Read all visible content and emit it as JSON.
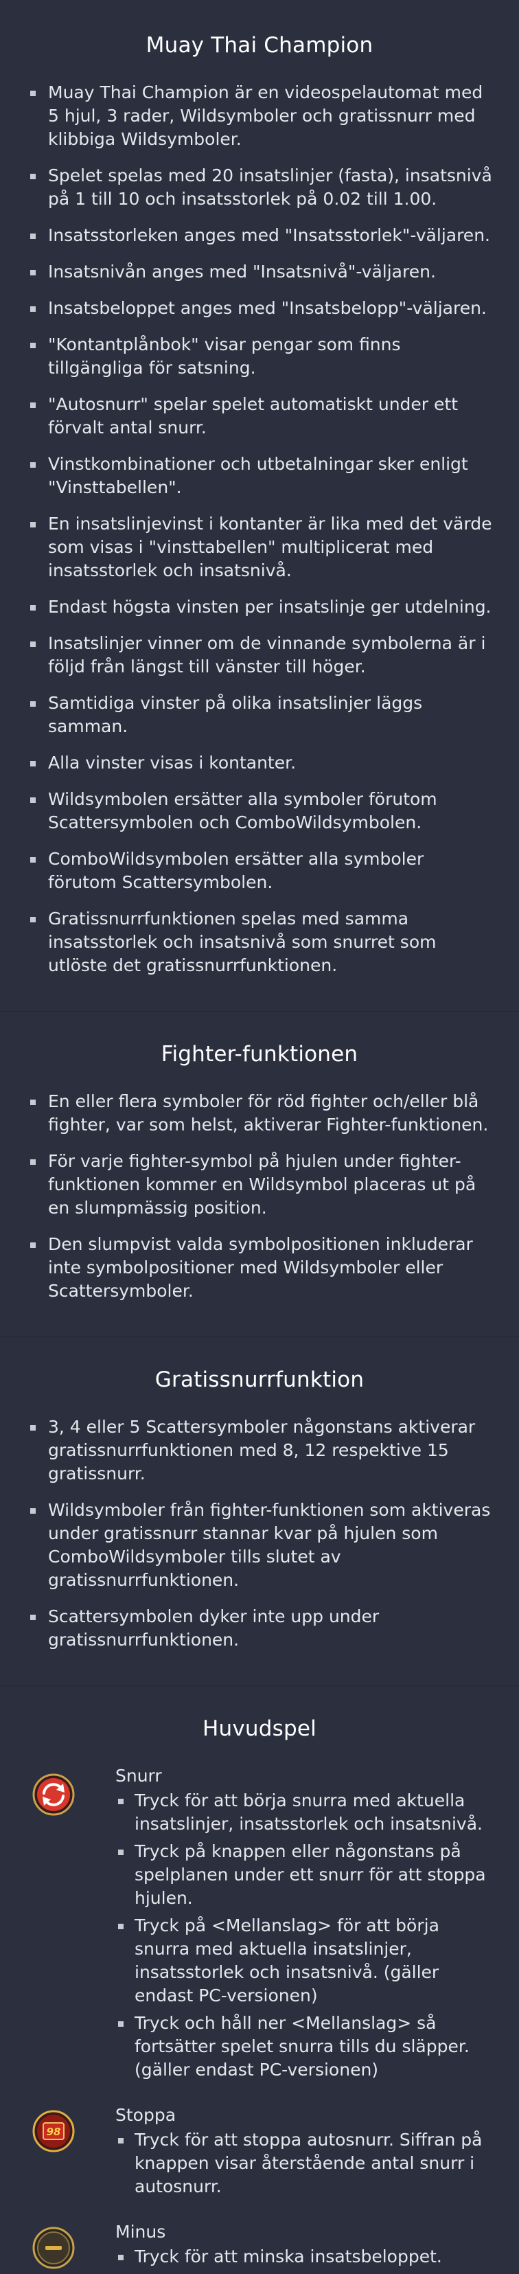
{
  "intro": {
    "title": "Muay Thai Champion",
    "items": [
      "Muay Thai Champion är en videospelautomat med 5 hjul, 3 rader, Wildsymboler och gratissnurr med klibbiga Wildsymboler.",
      "Spelet spelas med 20 insatslinjer (fasta), insatsnivå på 1 till 10 och insatsstorlek på 0.02 till 1.00.",
      "Insatsstorleken anges med \"Insatsstorlek\"-väljaren.",
      "Insatsnivån anges med \"Insatsnivå\"-väljaren.",
      "Insatsbeloppet anges med \"Insatsbelopp\"-väljaren.",
      "\"Kontantplånbok\" visar pengar som finns tillgängliga för satsning.",
      "\"Autosnurr\" spelar spelet automatiskt under ett förvalt antal snurr.",
      "Vinstkombinationer och utbetalningar sker enligt \"Vinsttabellen\".",
      "En insatslinjevinst i kontanter är lika med det värde som visas i \"vinsttabellen\" multiplicerat med insatsstorlek och insatsnivå.",
      "Endast högsta vinsten per insatslinje ger utdelning.",
      "Insatslinjer vinner om de vinnande symbolerna är i följd från längst till vänster till höger.",
      "Samtidiga vinster på olika insatslinjer läggs samman.",
      "Alla vinster visas i kontanter.",
      "Wildsymbolen ersätter alla symboler förutom Scattersymbolen och ComboWildsymbolen.",
      "ComboWildsymbolen ersätter alla symboler förutom Scattersymbolen.",
      "Gratissnurrfunktionen spelas med samma insatsstorlek och insatsnivå som snurret som utlöste det gratissnurrfunktionen."
    ]
  },
  "fighter": {
    "title": "Fighter-funktionen",
    "items": [
      "En eller flera symboler för röd fighter och/eller blå fighter, var som helst, aktiverar Fighter-funktionen.",
      "För varje fighter-symbol på hjulen under fighter-funktionen kommer en Wildsymbol placeras ut på en slumpmässig position.",
      "Den slumpvist valda symbolpositionen inkluderar inte symbolpositioner med Wildsymboler eller Scattersymboler."
    ]
  },
  "freespins": {
    "title": "Gratissnurrfunktion",
    "items": [
      "3, 4 eller 5 Scattersymboler någonstans aktiverar gratissnurrfunktionen med 8, 12 respektive 15 gratissnurr.",
      "Wildsymboler från fighter-funktionen som aktiveras under gratissnurr stannar kvar på hjulen som ComboWildsymboler tills slutet av gratissnurrfunktionen.",
      "Scattersymbolen dyker inte upp under gratissnurrfunktionen."
    ]
  },
  "main": {
    "title": "Huvudspel",
    "spin": {
      "icon": "spin-icon",
      "title": "Snurr",
      "items": [
        "Tryck för att börja snurra med aktuella insatslinjer, insatsstorlek och insatsnivå.",
        "Tryck på knappen eller någonstans på spelplanen under ett snurr för att stoppa hjulen.",
        "Tryck på <Mellanslag> för att börja snurra med aktuella insatslinjer, insatsstorlek och insatsnivå. (gäller endast PC-versionen)",
        "Tryck och håll ner <Mellanslag> så fortsätter spelet snurra tills du släpper. (gäller endast PC-versionen)"
      ]
    },
    "stop": {
      "icon": "stop-autospin-icon",
      "badge": "98",
      "title": "Stoppa",
      "items": [
        "Tryck för att stoppa autosnurr. Siffran på knappen visar återstående antal snurr i autosnurr."
      ]
    },
    "minus": {
      "icon": "minus-icon",
      "title": "Minus",
      "items": [
        "Tryck för att minska insatsbeloppet."
      ]
    }
  },
  "colors": {
    "background": "#2b2f3e",
    "text": "#e6e7ec",
    "spin_icon_red": "#d8382c",
    "stop_icon_gold": "#e0b040"
  }
}
